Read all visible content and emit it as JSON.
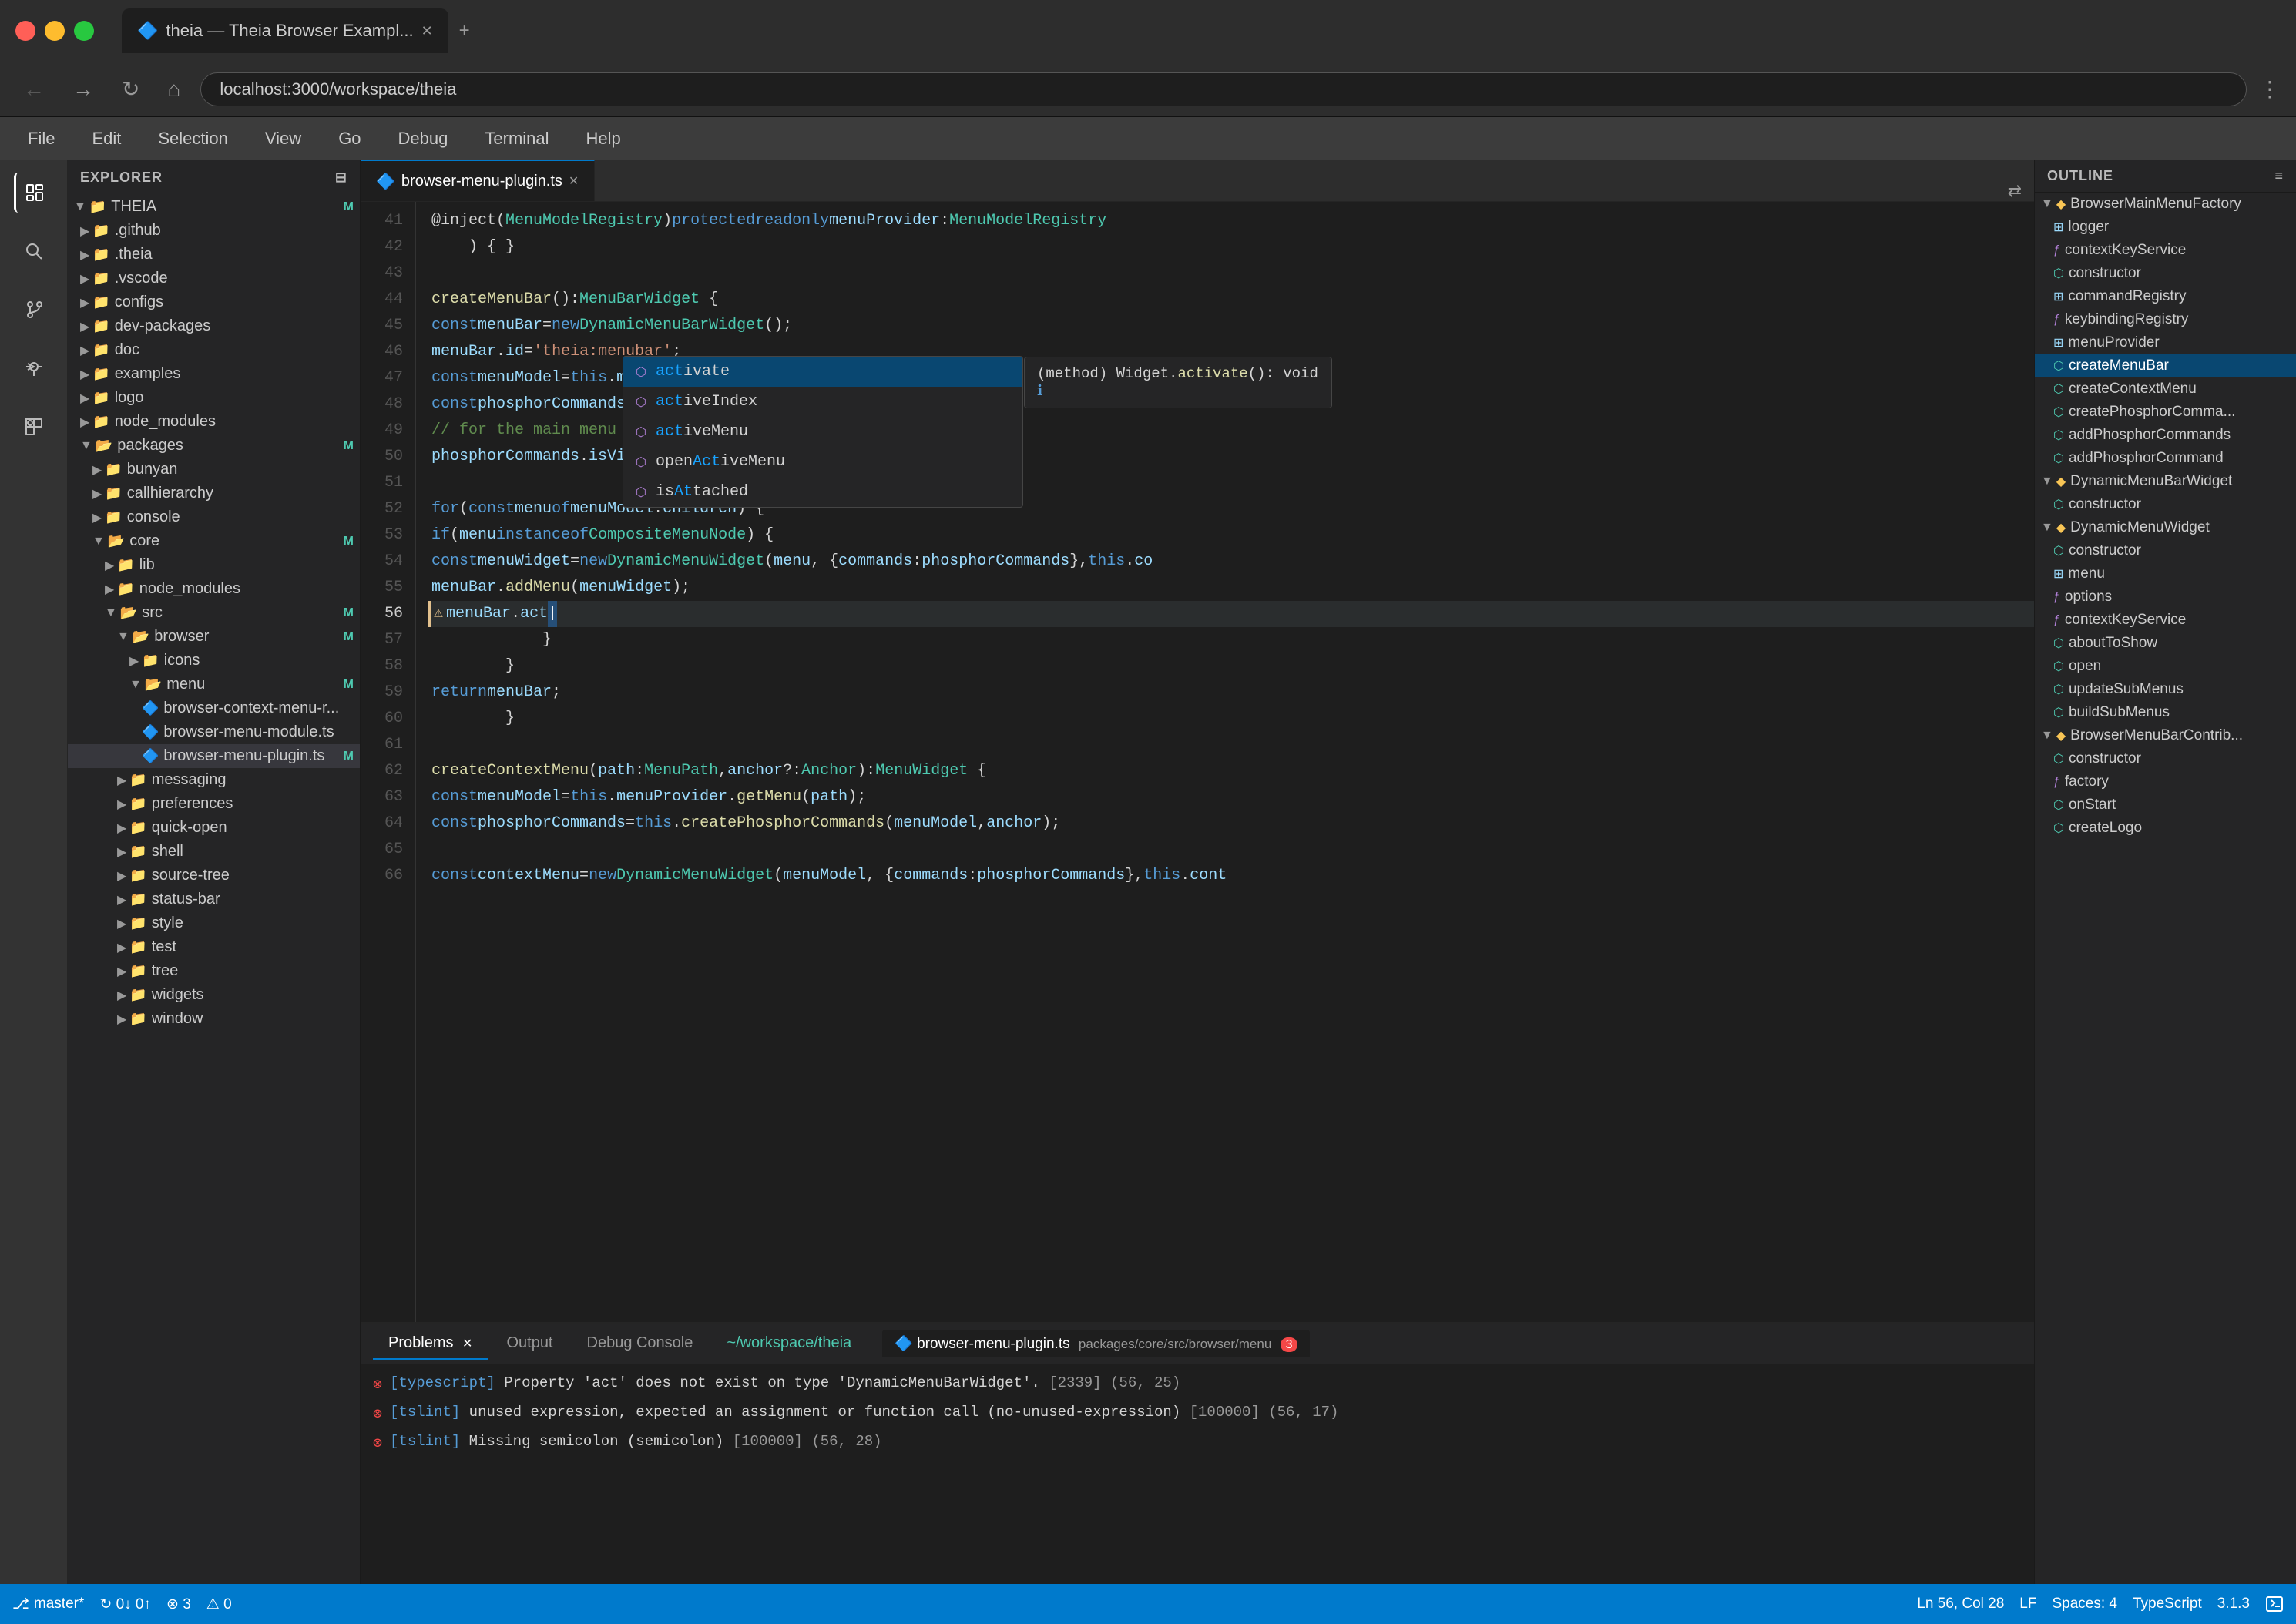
{
  "titlebar": {
    "tab_label": "theia — Theia Browser Exampl...",
    "new_tab": "+"
  },
  "navbar": {
    "url": "localhost:3000/workspace/theia"
  },
  "menubar": {
    "items": [
      "File",
      "Edit",
      "Selection",
      "View",
      "Go",
      "Debug",
      "Terminal",
      "Help"
    ]
  },
  "sidebar": {
    "header": "EXPLORER",
    "collapse_icon": "⊟",
    "tree": [
      {
        "label": "THEIA",
        "indent": 0,
        "type": "folder-open",
        "badge": "M",
        "expanded": true
      },
      {
        "label": ".github",
        "indent": 1,
        "type": "folder"
      },
      {
        "label": ".theia",
        "indent": 1,
        "type": "folder"
      },
      {
        "label": ".vscode",
        "indent": 1,
        "type": "folder"
      },
      {
        "label": "configs",
        "indent": 1,
        "type": "folder"
      },
      {
        "label": "dev-packages",
        "indent": 1,
        "type": "folder"
      },
      {
        "label": "doc",
        "indent": 1,
        "type": "folder"
      },
      {
        "label": "examples",
        "indent": 1,
        "type": "folder"
      },
      {
        "label": "logo",
        "indent": 1,
        "type": "folder"
      },
      {
        "label": "node_modules",
        "indent": 1,
        "type": "folder"
      },
      {
        "label": "packages",
        "indent": 1,
        "type": "folder-open",
        "badge": "M",
        "expanded": true
      },
      {
        "label": "bunyan",
        "indent": 2,
        "type": "folder"
      },
      {
        "label": "callhierarchy",
        "indent": 2,
        "type": "folder"
      },
      {
        "label": "console",
        "indent": 2,
        "type": "folder"
      },
      {
        "label": "core",
        "indent": 2,
        "type": "folder-open",
        "badge": "M",
        "expanded": true
      },
      {
        "label": "lib",
        "indent": 3,
        "type": "folder"
      },
      {
        "label": "node_modules",
        "indent": 3,
        "type": "folder"
      },
      {
        "label": "src",
        "indent": 3,
        "type": "folder-open",
        "badge": "M",
        "expanded": true
      },
      {
        "label": "browser",
        "indent": 4,
        "type": "folder-open",
        "badge": "M",
        "expanded": true
      },
      {
        "label": "icons",
        "indent": 5,
        "type": "folder"
      },
      {
        "label": "menu",
        "indent": 5,
        "type": "folder-open",
        "badge": "M",
        "expanded": true
      },
      {
        "label": "browser-context-menu-r...",
        "indent": 6,
        "type": "file"
      },
      {
        "label": "browser-menu-module.ts",
        "indent": 6,
        "type": "file"
      },
      {
        "label": "browser-menu-plugin.ts",
        "indent": 6,
        "type": "file",
        "active": true,
        "badge": "M"
      },
      {
        "label": "messaging",
        "indent": 4,
        "type": "folder"
      },
      {
        "label": "preferences",
        "indent": 4,
        "type": "folder"
      },
      {
        "label": "quick-open",
        "indent": 4,
        "type": "folder"
      },
      {
        "label": "shell",
        "indent": 4,
        "type": "folder"
      },
      {
        "label": "source-tree",
        "indent": 4,
        "type": "folder"
      },
      {
        "label": "status-bar",
        "indent": 4,
        "type": "folder"
      },
      {
        "label": "style",
        "indent": 4,
        "type": "folder"
      },
      {
        "label": "test",
        "indent": 4,
        "type": "folder"
      },
      {
        "label": "tree",
        "indent": 4,
        "type": "folder"
      },
      {
        "label": "widgets",
        "indent": 4,
        "type": "folder"
      },
      {
        "label": "window",
        "indent": 4,
        "type": "folder"
      }
    ]
  },
  "editor": {
    "tab_name": "browser-menu-plugin.ts",
    "lines": [
      {
        "num": 41,
        "code": "    @inject(MenuModelRegistry) protected readonly menuProvider: MenuModelRegistry"
      },
      {
        "num": 42,
        "code": "    ) { }"
      },
      {
        "num": 43,
        "code": ""
      },
      {
        "num": 44,
        "code": "    createMenuBar(): MenuBarWidget {"
      },
      {
        "num": 45,
        "code": "        const menuBar = new DynamicMenuBarWidget();"
      },
      {
        "num": 46,
        "code": "        menuBar.id = 'theia:menubar';"
      },
      {
        "num": 47,
        "code": "        const menuModel = this.menuProvider.getMenu(MAIN_MENU_BAR);"
      },
      {
        "num": 48,
        "code": "        const phosphorCommands = this.createPhosphorCommands(menuModel);"
      },
      {
        "num": 49,
        "code": "        // for the main menu we want all items to be visible."
      },
      {
        "num": 50,
        "code": "        phosphorCommands.isVisible = () => true;"
      },
      {
        "num": 51,
        "code": ""
      },
      {
        "num": 52,
        "code": "        for (const menu of menuModel.children) {"
      },
      {
        "num": 53,
        "code": "            if (menu instanceof CompositeMenuNode) {"
      },
      {
        "num": 54,
        "code": "                const menuWidget = new DynamicMenuWidget(menu, { commands: phosphorCommands }, this.co"
      },
      {
        "num": 55,
        "code": "                menuBar.addMenu(menuWidget);"
      },
      {
        "num": 56,
        "code": "                menuBar.act",
        "warning": true,
        "current": true
      },
      {
        "num": 57,
        "code": "            }"
      },
      {
        "num": 58,
        "code": "        }"
      },
      {
        "num": 59,
        "code": "        return menuBar;"
      },
      {
        "num": 60,
        "code": "        }"
      },
      {
        "num": 61,
        "code": ""
      },
      {
        "num": 62,
        "code": "    createContextMenu(path: MenuPath, anchor?: Anchor): MenuWidget {"
      },
      {
        "num": 63,
        "code": "        const menuModel = this.menuProvider.getMenu(path);"
      },
      {
        "num": 64,
        "code": "        const phosphorCommands = this.createPhosphorCommands(menuModel, anchor);"
      },
      {
        "num": 65,
        "code": ""
      },
      {
        "num": 66,
        "code": "        const contextMenu = new DynamicMenuWidget(menuModel, { commands: phosphorCommands }, this.cont"
      }
    ],
    "autocomplete": {
      "items": [
        {
          "icon": "⬡",
          "label": "activate",
          "match": "act",
          "type": "(method) Widget.activate(): void",
          "info": "ℹ",
          "selected": true
        },
        {
          "icon": "⬡",
          "label": "activeIndex",
          "match": "act"
        },
        {
          "icon": "⬡",
          "label": "activeMenu",
          "match": "act"
        },
        {
          "icon": "⬡",
          "label": "openActiveMenu",
          "match": "act"
        },
        {
          "icon": "⬡",
          "label": "isAttached",
          "match": ""
        }
      ]
    }
  },
  "outline": {
    "header": "OUTLINE",
    "items": [
      {
        "label": "BrowserMainMenuFactory",
        "indent": 0,
        "type": "class",
        "expanded": true
      },
      {
        "label": "logger",
        "indent": 1,
        "type": "property"
      },
      {
        "label": "contextKeyService",
        "indent": 1,
        "type": "method"
      },
      {
        "label": "constructor",
        "indent": 1,
        "type": "constructor"
      },
      {
        "label": "commandRegistry",
        "indent": 1,
        "type": "property"
      },
      {
        "label": "keybindingRegistry",
        "indent": 1,
        "type": "property"
      },
      {
        "label": "menuProvider",
        "indent": 1,
        "type": "property"
      },
      {
        "label": "createMenuBar",
        "indent": 1,
        "type": "method",
        "active": true
      },
      {
        "label": "createContextMenu",
        "indent": 1,
        "type": "method"
      },
      {
        "label": "createPhosphorComma...",
        "indent": 1,
        "type": "method"
      },
      {
        "label": "addPhosphorCommands",
        "indent": 1,
        "type": "method"
      },
      {
        "label": "addPhosphorCommand",
        "indent": 1,
        "type": "method"
      },
      {
        "label": "DynamicMenuBarWidget",
        "indent": 0,
        "type": "class",
        "expanded": true
      },
      {
        "label": "constructor",
        "indent": 1,
        "type": "constructor"
      },
      {
        "label": "DynamicMenuWidget",
        "indent": 0,
        "type": "class",
        "expanded": true
      },
      {
        "label": "constructor",
        "indent": 1,
        "type": "constructor"
      },
      {
        "label": "menu",
        "indent": 1,
        "type": "property"
      },
      {
        "label": "options",
        "indent": 1,
        "type": "property"
      },
      {
        "label": "contextKeyService",
        "indent": 1,
        "type": "method"
      },
      {
        "label": "aboutToShow",
        "indent": 1,
        "type": "method"
      },
      {
        "label": "open",
        "indent": 1,
        "type": "method"
      },
      {
        "label": "updateSubMenus",
        "indent": 1,
        "type": "method"
      },
      {
        "label": "buildSubMenus",
        "indent": 1,
        "type": "method"
      },
      {
        "label": "BrowserMenuBarContrib...",
        "indent": 0,
        "type": "class",
        "expanded": true
      },
      {
        "label": "constructor",
        "indent": 1,
        "type": "constructor"
      },
      {
        "label": "factory",
        "indent": 1,
        "type": "property"
      },
      {
        "label": "onStart",
        "indent": 1,
        "type": "method"
      },
      {
        "label": "createLogo",
        "indent": 1,
        "type": "method"
      }
    ]
  },
  "panel": {
    "tabs": [
      "Problems",
      "Output",
      "Debug Console"
    ],
    "active_tab": "Problems",
    "terminal_label": "~/workspace/theia",
    "file_tabs": [
      "browser-menu-plugin.ts"
    ],
    "file_path": "packages/core/src/browser/menu",
    "error_count": "3",
    "errors": [
      {
        "type": "error",
        "text": "[typescript] Property 'act' does not exist on type 'DynamicMenuBarWidget'.",
        "code": "[2339]",
        "loc": "(56, 25)"
      },
      {
        "type": "error",
        "text": "[tslint] unused expression, expected an assignment or function call (no-unused-expression)",
        "code": "[100000]",
        "loc": "(56, 17)"
      },
      {
        "type": "error",
        "text": "[tslint] Missing semicolon (semicolon)",
        "code": "[100000]",
        "loc": "(56, 28)"
      }
    ]
  },
  "statusbar": {
    "branch": "⎇ master*",
    "sync": "↻ 0↓ 0↑",
    "errors": "⊗ 3",
    "warnings": "⚠ 0",
    "position": "Ln 56, Col 28",
    "encoding": "LF",
    "spaces": "Spaces: 4",
    "language": "TypeScript",
    "version": "3.1.3"
  },
  "activity_bar": {
    "icons": [
      "explorer",
      "search",
      "git",
      "debug",
      "extensions"
    ]
  }
}
